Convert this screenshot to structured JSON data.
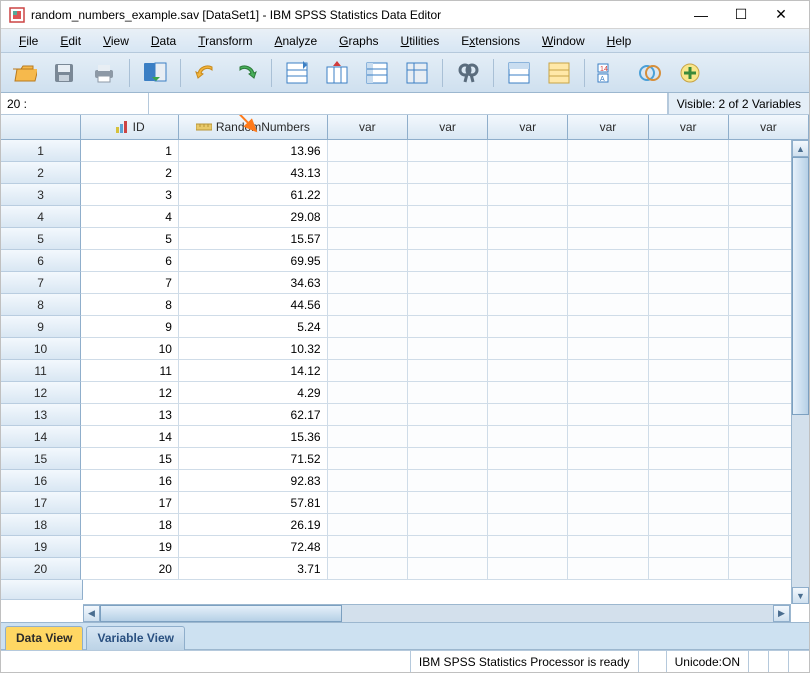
{
  "window": {
    "title": "random_numbers_example.sav [DataSet1] - IBM SPSS Statistics Data Editor",
    "min": "—",
    "max": "☐",
    "close": "✕"
  },
  "menu": [
    "File",
    "Edit",
    "View",
    "Data",
    "Transform",
    "Analyze",
    "Graphs",
    "Utilities",
    "Extensions",
    "Window",
    "Help"
  ],
  "info": {
    "cellname": "20 :",
    "visible": "Visible: 2 of 2 Variables"
  },
  "columns": {
    "id": "ID",
    "rnd": "RandomNumbers",
    "var": "var"
  },
  "rows": [
    {
      "n": "1",
      "id": "1",
      "rnd": "13.96"
    },
    {
      "n": "2",
      "id": "2",
      "rnd": "43.13"
    },
    {
      "n": "3",
      "id": "3",
      "rnd": "61.22"
    },
    {
      "n": "4",
      "id": "4",
      "rnd": "29.08"
    },
    {
      "n": "5",
      "id": "5",
      "rnd": "15.57"
    },
    {
      "n": "6",
      "id": "6",
      "rnd": "69.95"
    },
    {
      "n": "7",
      "id": "7",
      "rnd": "34.63"
    },
    {
      "n": "8",
      "id": "8",
      "rnd": "44.56"
    },
    {
      "n": "9",
      "id": "9",
      "rnd": "5.24"
    },
    {
      "n": "10",
      "id": "10",
      "rnd": "10.32"
    },
    {
      "n": "11",
      "id": "11",
      "rnd": "14.12"
    },
    {
      "n": "12",
      "id": "12",
      "rnd": "4.29"
    },
    {
      "n": "13",
      "id": "13",
      "rnd": "62.17"
    },
    {
      "n": "14",
      "id": "14",
      "rnd": "15.36"
    },
    {
      "n": "15",
      "id": "15",
      "rnd": "71.52"
    },
    {
      "n": "16",
      "id": "16",
      "rnd": "92.83"
    },
    {
      "n": "17",
      "id": "17",
      "rnd": "57.81"
    },
    {
      "n": "18",
      "id": "18",
      "rnd": "26.19"
    },
    {
      "n": "19",
      "id": "19",
      "rnd": "72.48"
    },
    {
      "n": "20",
      "id": "20",
      "rnd": "3.71"
    }
  ],
  "tabs": {
    "data": "Data View",
    "var": "Variable View"
  },
  "status": {
    "processor": "IBM SPSS Statistics Processor is ready",
    "unicode": "Unicode:ON"
  }
}
